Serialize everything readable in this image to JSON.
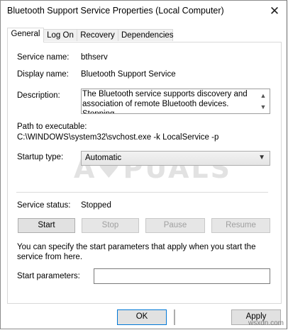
{
  "window": {
    "title": "Bluetooth Support Service Properties (Local Computer)"
  },
  "tabs": [
    {
      "label": "General"
    },
    {
      "label": "Log On"
    },
    {
      "label": "Recovery"
    },
    {
      "label": "Dependencies"
    }
  ],
  "general": {
    "service_name_label": "Service name:",
    "service_name": "bthserv",
    "display_name_label": "Display name:",
    "display_name": "Bluetooth Support Service",
    "description_label": "Description:",
    "description": "The Bluetooth service supports discovery and association of remote Bluetooth devices.  Stopping",
    "path_label": "Path to executable:",
    "path": "C:\\WINDOWS\\system32\\svchost.exe -k LocalService -p",
    "startup_type_label": "Startup type:",
    "startup_type": "Automatic",
    "service_status_label": "Service status:",
    "service_status": "Stopped",
    "buttons": {
      "start": "Start",
      "stop": "Stop",
      "pause": "Pause",
      "resume": "Resume"
    },
    "hint": "You can specify the start parameters that apply when you start the service from here.",
    "start_params_label": "Start parameters:",
    "start_params_value": ""
  },
  "footer": {
    "ok": "OK",
    "apply": "Apply"
  },
  "watermark": "A PUALS",
  "corner_text": "wsxdn.com"
}
